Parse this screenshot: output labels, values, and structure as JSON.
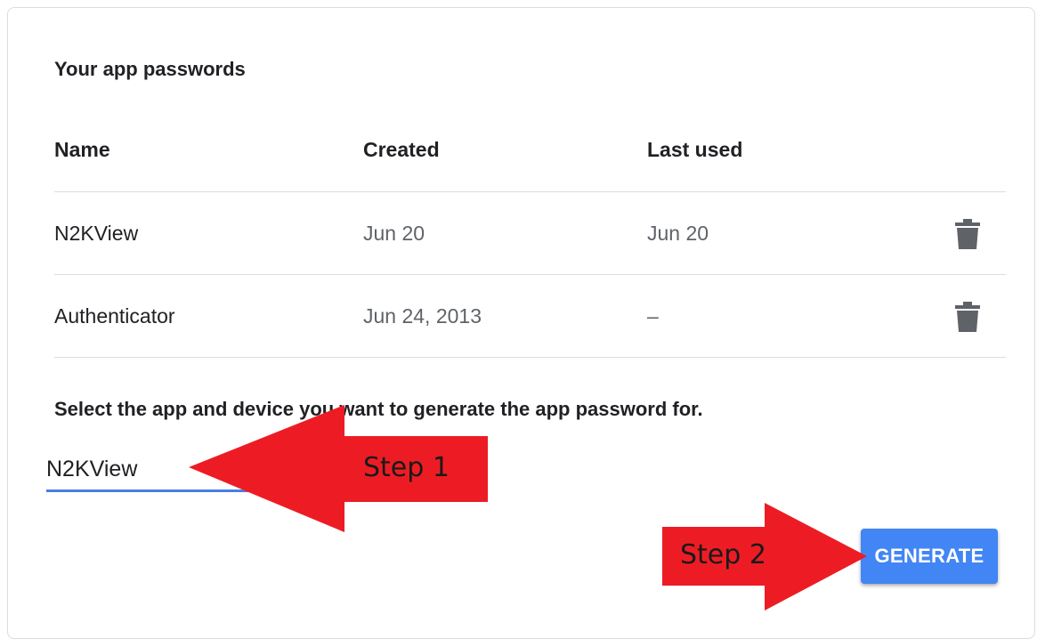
{
  "section_title": "Your app passwords",
  "table": {
    "headers": {
      "name": "Name",
      "created": "Created",
      "last_used": "Last used"
    },
    "rows": [
      {
        "name": "N2KView",
        "created": "Jun 20",
        "last_used": "Jun 20"
      },
      {
        "name": "Authenticator",
        "created": "Jun 24, 2013",
        "last_used": "–"
      }
    ]
  },
  "instruction": "Select the app and device you want to generate the app password for.",
  "app_input": {
    "value": "N2KView"
  },
  "generate_label": "GENERATE",
  "annotations": {
    "step1": "Step 1",
    "step2": "Step 2"
  },
  "colors": {
    "accent": "#4285f4",
    "annotation_red": "#ed1c24",
    "underline": "#4a7fe0",
    "icon": "#5f6368"
  },
  "icons": {
    "delete": "trash-icon"
  }
}
